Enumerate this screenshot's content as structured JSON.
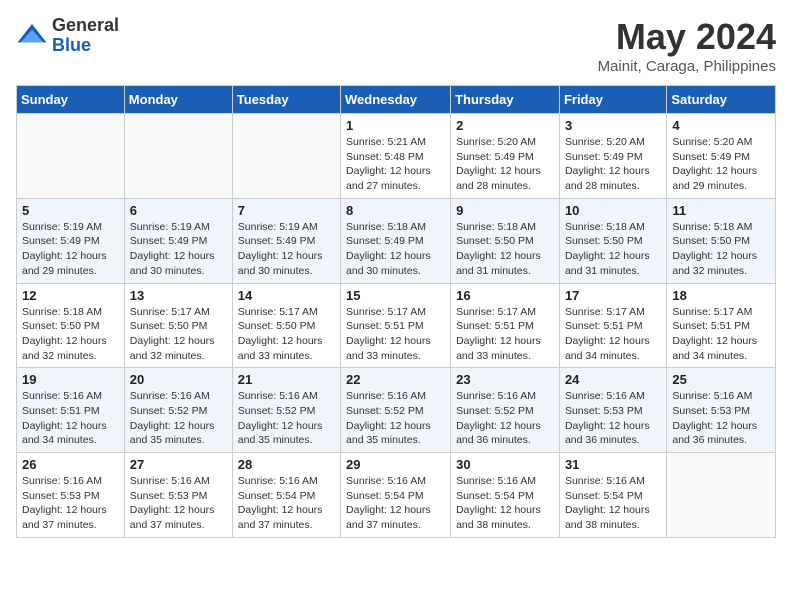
{
  "logo": {
    "general": "General",
    "blue": "Blue"
  },
  "title": "May 2024",
  "location": "Mainit, Caraga, Philippines",
  "days_header": [
    "Sunday",
    "Monday",
    "Tuesday",
    "Wednesday",
    "Thursday",
    "Friday",
    "Saturday"
  ],
  "weeks": [
    [
      {
        "day": "",
        "info": ""
      },
      {
        "day": "",
        "info": ""
      },
      {
        "day": "",
        "info": ""
      },
      {
        "day": "1",
        "info": "Sunrise: 5:21 AM\nSunset: 5:48 PM\nDaylight: 12 hours\nand 27 minutes."
      },
      {
        "day": "2",
        "info": "Sunrise: 5:20 AM\nSunset: 5:49 PM\nDaylight: 12 hours\nand 28 minutes."
      },
      {
        "day": "3",
        "info": "Sunrise: 5:20 AM\nSunset: 5:49 PM\nDaylight: 12 hours\nand 28 minutes."
      },
      {
        "day": "4",
        "info": "Sunrise: 5:20 AM\nSunset: 5:49 PM\nDaylight: 12 hours\nand 29 minutes."
      }
    ],
    [
      {
        "day": "5",
        "info": "Sunrise: 5:19 AM\nSunset: 5:49 PM\nDaylight: 12 hours\nand 29 minutes."
      },
      {
        "day": "6",
        "info": "Sunrise: 5:19 AM\nSunset: 5:49 PM\nDaylight: 12 hours\nand 30 minutes."
      },
      {
        "day": "7",
        "info": "Sunrise: 5:19 AM\nSunset: 5:49 PM\nDaylight: 12 hours\nand 30 minutes."
      },
      {
        "day": "8",
        "info": "Sunrise: 5:18 AM\nSunset: 5:49 PM\nDaylight: 12 hours\nand 30 minutes."
      },
      {
        "day": "9",
        "info": "Sunrise: 5:18 AM\nSunset: 5:50 PM\nDaylight: 12 hours\nand 31 minutes."
      },
      {
        "day": "10",
        "info": "Sunrise: 5:18 AM\nSunset: 5:50 PM\nDaylight: 12 hours\nand 31 minutes."
      },
      {
        "day": "11",
        "info": "Sunrise: 5:18 AM\nSunset: 5:50 PM\nDaylight: 12 hours\nand 32 minutes."
      }
    ],
    [
      {
        "day": "12",
        "info": "Sunrise: 5:18 AM\nSunset: 5:50 PM\nDaylight: 12 hours\nand 32 minutes."
      },
      {
        "day": "13",
        "info": "Sunrise: 5:17 AM\nSunset: 5:50 PM\nDaylight: 12 hours\nand 32 minutes."
      },
      {
        "day": "14",
        "info": "Sunrise: 5:17 AM\nSunset: 5:50 PM\nDaylight: 12 hours\nand 33 minutes."
      },
      {
        "day": "15",
        "info": "Sunrise: 5:17 AM\nSunset: 5:51 PM\nDaylight: 12 hours\nand 33 minutes."
      },
      {
        "day": "16",
        "info": "Sunrise: 5:17 AM\nSunset: 5:51 PM\nDaylight: 12 hours\nand 33 minutes."
      },
      {
        "day": "17",
        "info": "Sunrise: 5:17 AM\nSunset: 5:51 PM\nDaylight: 12 hours\nand 34 minutes."
      },
      {
        "day": "18",
        "info": "Sunrise: 5:17 AM\nSunset: 5:51 PM\nDaylight: 12 hours\nand 34 minutes."
      }
    ],
    [
      {
        "day": "19",
        "info": "Sunrise: 5:16 AM\nSunset: 5:51 PM\nDaylight: 12 hours\nand 34 minutes."
      },
      {
        "day": "20",
        "info": "Sunrise: 5:16 AM\nSunset: 5:52 PM\nDaylight: 12 hours\nand 35 minutes."
      },
      {
        "day": "21",
        "info": "Sunrise: 5:16 AM\nSunset: 5:52 PM\nDaylight: 12 hours\nand 35 minutes."
      },
      {
        "day": "22",
        "info": "Sunrise: 5:16 AM\nSunset: 5:52 PM\nDaylight: 12 hours\nand 35 minutes."
      },
      {
        "day": "23",
        "info": "Sunrise: 5:16 AM\nSunset: 5:52 PM\nDaylight: 12 hours\nand 36 minutes."
      },
      {
        "day": "24",
        "info": "Sunrise: 5:16 AM\nSunset: 5:53 PM\nDaylight: 12 hours\nand 36 minutes."
      },
      {
        "day": "25",
        "info": "Sunrise: 5:16 AM\nSunset: 5:53 PM\nDaylight: 12 hours\nand 36 minutes."
      }
    ],
    [
      {
        "day": "26",
        "info": "Sunrise: 5:16 AM\nSunset: 5:53 PM\nDaylight: 12 hours\nand 37 minutes."
      },
      {
        "day": "27",
        "info": "Sunrise: 5:16 AM\nSunset: 5:53 PM\nDaylight: 12 hours\nand 37 minutes."
      },
      {
        "day": "28",
        "info": "Sunrise: 5:16 AM\nSunset: 5:54 PM\nDaylight: 12 hours\nand 37 minutes."
      },
      {
        "day": "29",
        "info": "Sunrise: 5:16 AM\nSunset: 5:54 PM\nDaylight: 12 hours\nand 37 minutes."
      },
      {
        "day": "30",
        "info": "Sunrise: 5:16 AM\nSunset: 5:54 PM\nDaylight: 12 hours\nand 38 minutes."
      },
      {
        "day": "31",
        "info": "Sunrise: 5:16 AM\nSunset: 5:54 PM\nDaylight: 12 hours\nand 38 minutes."
      },
      {
        "day": "",
        "info": ""
      }
    ]
  ]
}
